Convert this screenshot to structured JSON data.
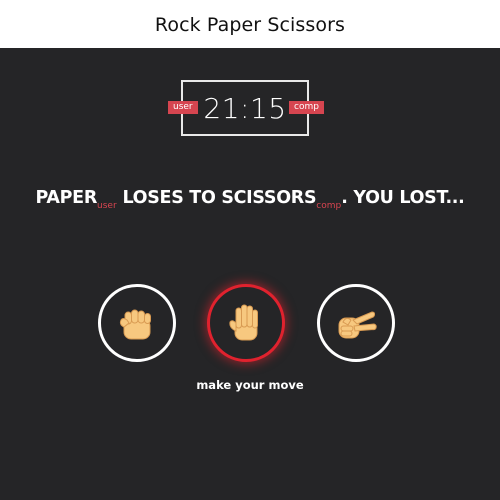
{
  "header": {
    "title": "Rock Paper Scissors"
  },
  "scoreboard": {
    "user_label": "user",
    "comp_label": "comp",
    "score": "21:15"
  },
  "result": {
    "user_choice": "PAPER",
    "user_tag": "user",
    "verb": "LOSES TO",
    "comp_choice": "SCISSORS",
    "comp_tag": "comp",
    "outcome": ". YOU LOST..."
  },
  "choices": [
    {
      "name": "rock",
      "icon": "rock-hand-icon",
      "selected": false
    },
    {
      "name": "paper",
      "icon": "paper-hand-icon",
      "selected": true
    },
    {
      "name": "scissors",
      "icon": "scissors-hand-icon",
      "selected": false
    }
  ],
  "hint": "make your move",
  "colors": {
    "background": "#252527",
    "accent": "#d64550",
    "selected_ring": "#e0222e",
    "skin": "#f7c87f"
  }
}
